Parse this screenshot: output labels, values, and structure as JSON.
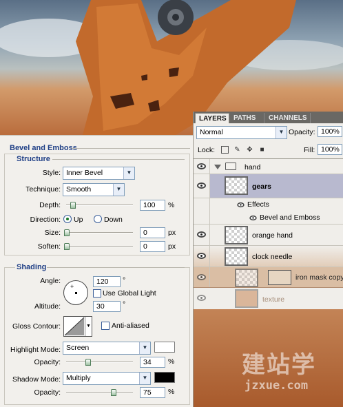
{
  "bevel": {
    "title": "Bevel and Emboss",
    "structure": {
      "title": "Structure",
      "style_label": "Style:",
      "style_value": "Inner Bevel",
      "technique_label": "Technique:",
      "technique_value": "Smooth",
      "depth_label": "Depth:",
      "depth_value": "100",
      "depth_unit": "%",
      "depth_level": 0.1,
      "direction_label": "Direction:",
      "dir_up": "Up",
      "dir_down": "Down",
      "direction_selected": "Up",
      "size_label": "Size:",
      "size_value": "0",
      "size_unit": "px",
      "size_level": 0,
      "soften_label": "Soften:",
      "soften_value": "0",
      "soften_unit": "px",
      "soften_level": 0
    },
    "shading": {
      "title": "Shading",
      "angle_label": "Angle:",
      "angle_value": "120",
      "angle_unit": "°",
      "global_light": "Use Global Light",
      "global_light_checked": false,
      "altitude_label": "Altitude:",
      "altitude_value": "30",
      "altitude_unit": "°",
      "gloss_label": "Gloss Contour:",
      "anti_aliased": "Anti-aliased",
      "anti_aliased_checked": false,
      "highlight_label": "Highlight Mode:",
      "highlight_value": "Screen",
      "highlight_color": "#ffffff",
      "opacity1_label": "Opacity:",
      "opacity1_value": "34",
      "opacity1_unit": "%",
      "opacity1_level": 0.34,
      "shadow_label": "Shadow Mode:",
      "shadow_value": "Multiply",
      "shadow_color": "#000000",
      "opacity2_label": "Opacity:",
      "opacity2_value": "75",
      "opacity2_unit": "%",
      "opacity2_level": 0.75
    }
  },
  "layers_panel": {
    "tabs": [
      "LAYERS",
      "PATHS",
      "CHANNELS"
    ],
    "blend_mode": "Normal",
    "opacity_label": "Opacity:",
    "opacity_value": "100%",
    "lock_label": "Lock:",
    "fill_label": "Fill:",
    "fill_value": "100%",
    "items": [
      {
        "name": "hand",
        "kind": "group"
      },
      {
        "name": "gears",
        "kind": "layer",
        "selected": true
      },
      {
        "name": "Effects",
        "kind": "effects"
      },
      {
        "name": "Bevel and Emboss",
        "kind": "effect"
      },
      {
        "name": "orange hand",
        "kind": "layer"
      },
      {
        "name": "clock needle",
        "kind": "layer"
      },
      {
        "name": "iron mask copy",
        "kind": "layer"
      },
      {
        "name": "texture",
        "kind": "layer"
      }
    ]
  },
  "watermark": {
    "text": "jzxue.com"
  },
  "colors": {
    "accent": "#1f3f86",
    "selected_row": "#b8b9cf"
  }
}
